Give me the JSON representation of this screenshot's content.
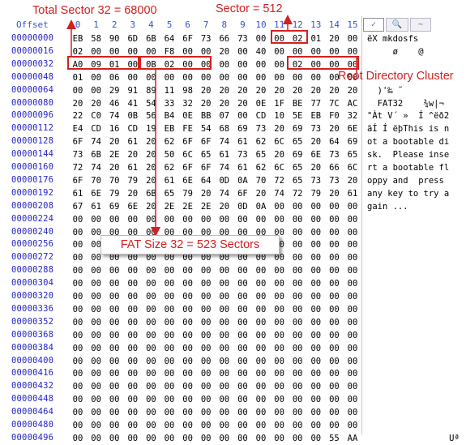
{
  "header": {
    "offset_label": "Offset",
    "columns": [
      "0",
      "1",
      "2",
      "3",
      "4",
      "5",
      "6",
      "7",
      "8",
      "9",
      "10",
      "11",
      "12",
      "13",
      "14",
      "15"
    ]
  },
  "toolbar": {
    "tab_1": "✓",
    "tab_2": "🔍",
    "tab_3": "~"
  },
  "annotations": {
    "total_sector": "Total Sector 32 = 68000",
    "sector_size": "Sector = 512",
    "root_dir": "Root Directory Cluster",
    "fat_size": "FAT Size 32 = 523 Sectors"
  },
  "colors": {
    "annotation": "#d42020",
    "offset_text": "#2424c8"
  },
  "rows": [
    {
      "offset": "00000000",
      "bytes": [
        "EB",
        "58",
        "90",
        "6D",
        "6B",
        "64",
        "6F",
        "73",
        "66",
        "73",
        "00",
        "00",
        "02",
        "01",
        "20",
        "00"
      ],
      "ascii": "ëX mkdosfs"
    },
    {
      "offset": "00000016",
      "bytes": [
        "02",
        "00",
        "00",
        "00",
        "00",
        "F8",
        "00",
        "00",
        "20",
        "00",
        "40",
        "00",
        "00",
        "00",
        "00",
        "00"
      ],
      "ascii": "     ø    @"
    },
    {
      "offset": "00000032",
      "bytes": [
        "A0",
        "09",
        "01",
        "00",
        "0B",
        "02",
        "00",
        "00",
        "00",
        "00",
        "00",
        "00",
        "02",
        "00",
        "00",
        "00"
      ],
      "ascii": ""
    },
    {
      "offset": "00000048",
      "bytes": [
        "01",
        "00",
        "06",
        "00",
        "00",
        "00",
        "00",
        "00",
        "00",
        "00",
        "00",
        "00",
        "00",
        "00",
        "00",
        "00"
      ],
      "ascii": ""
    },
    {
      "offset": "00000064",
      "bytes": [
        "00",
        "00",
        "29",
        "91",
        "89",
        "11",
        "98",
        "20",
        "20",
        "20",
        "20",
        "20",
        "20",
        "20",
        "20",
        "20"
      ],
      "ascii": "  )'‰ ˜"
    },
    {
      "offset": "00000080",
      "bytes": [
        "20",
        "20",
        "46",
        "41",
        "54",
        "33",
        "32",
        "20",
        "20",
        "20",
        "0E",
        "1F",
        "BE",
        "77",
        "7C",
        "AC"
      ],
      "ascii": "  FAT32    ¾w|¬"
    },
    {
      "offset": "00000096",
      "bytes": [
        "22",
        "C0",
        "74",
        "0B",
        "56",
        "B4",
        "0E",
        "BB",
        "07",
        "00",
        "CD",
        "10",
        "5E",
        "EB",
        "F0",
        "32"
      ],
      "ascii": "\"Àt V´ »  Í ^ëð2"
    },
    {
      "offset": "00000112",
      "bytes": [
        "E4",
        "CD",
        "16",
        "CD",
        "19",
        "EB",
        "FE",
        "54",
        "68",
        "69",
        "73",
        "20",
        "69",
        "73",
        "20",
        "6E"
      ],
      "ascii": "äÍ Í ëþThis is n"
    },
    {
      "offset": "00000128",
      "bytes": [
        "6F",
        "74",
        "20",
        "61",
        "20",
        "62",
        "6F",
        "6F",
        "74",
        "61",
        "62",
        "6C",
        "65",
        "20",
        "64",
        "69"
      ],
      "ascii": "ot a bootable di"
    },
    {
      "offset": "00000144",
      "bytes": [
        "73",
        "6B",
        "2E",
        "20",
        "20",
        "50",
        "6C",
        "65",
        "61",
        "73",
        "65",
        "20",
        "69",
        "6E",
        "73",
        "65"
      ],
      "ascii": "sk.  Please inse"
    },
    {
      "offset": "00000160",
      "bytes": [
        "72",
        "74",
        "20",
        "61",
        "20",
        "62",
        "6F",
        "6F",
        "74",
        "61",
        "62",
        "6C",
        "65",
        "20",
        "66",
        "6C"
      ],
      "ascii": "rt a bootable fl"
    },
    {
      "offset": "00000176",
      "bytes": [
        "6F",
        "70",
        "70",
        "79",
        "20",
        "61",
        "6E",
        "64",
        "0D",
        "0A",
        "70",
        "72",
        "65",
        "73",
        "73",
        "20"
      ],
      "ascii": "oppy and  press "
    },
    {
      "offset": "00000192",
      "bytes": [
        "61",
        "6E",
        "79",
        "20",
        "6B",
        "65",
        "79",
        "20",
        "74",
        "6F",
        "20",
        "74",
        "72",
        "79",
        "20",
        "61"
      ],
      "ascii": "any key to try a"
    },
    {
      "offset": "00000208",
      "bytes": [
        "67",
        "61",
        "69",
        "6E",
        "20",
        "2E",
        "2E",
        "2E",
        "20",
        "0D",
        "0A",
        "00",
        "00",
        "00",
        "00",
        "00"
      ],
      "ascii": "gain ..."
    },
    {
      "offset": "00000224",
      "bytes": [
        "00",
        "00",
        "00",
        "00",
        "00",
        "00",
        "00",
        "00",
        "00",
        "00",
        "00",
        "00",
        "00",
        "00",
        "00",
        "00"
      ],
      "ascii": ""
    },
    {
      "offset": "00000240",
      "bytes": [
        "00",
        "00",
        "00",
        "00",
        "00",
        "00",
        "00",
        "00",
        "00",
        "00",
        "00",
        "00",
        "00",
        "00",
        "00",
        "00"
      ],
      "ascii": ""
    },
    {
      "offset": "00000256",
      "bytes": [
        "00",
        "00",
        "00",
        "00",
        "00",
        "00",
        "00",
        "00",
        "00",
        "00",
        "00",
        "00",
        "00",
        "00",
        "00",
        "00"
      ],
      "ascii": ""
    },
    {
      "offset": "00000272",
      "bytes": [
        "00",
        "00",
        "00",
        "00",
        "00",
        "00",
        "00",
        "00",
        "00",
        "00",
        "00",
        "00",
        "00",
        "00",
        "00",
        "00"
      ],
      "ascii": ""
    },
    {
      "offset": "00000288",
      "bytes": [
        "00",
        "00",
        "00",
        "00",
        "00",
        "00",
        "00",
        "00",
        "00",
        "00",
        "00",
        "00",
        "00",
        "00",
        "00",
        "00"
      ],
      "ascii": ""
    },
    {
      "offset": "00000304",
      "bytes": [
        "00",
        "00",
        "00",
        "00",
        "00",
        "00",
        "00",
        "00",
        "00",
        "00",
        "00",
        "00",
        "00",
        "00",
        "00",
        "00"
      ],
      "ascii": ""
    },
    {
      "offset": "00000320",
      "bytes": [
        "00",
        "00",
        "00",
        "00",
        "00",
        "00",
        "00",
        "00",
        "00",
        "00",
        "00",
        "00",
        "00",
        "00",
        "00",
        "00"
      ],
      "ascii": ""
    },
    {
      "offset": "00000336",
      "bytes": [
        "00",
        "00",
        "00",
        "00",
        "00",
        "00",
        "00",
        "00",
        "00",
        "00",
        "00",
        "00",
        "00",
        "00",
        "00",
        "00"
      ],
      "ascii": ""
    },
    {
      "offset": "00000352",
      "bytes": [
        "00",
        "00",
        "00",
        "00",
        "00",
        "00",
        "00",
        "00",
        "00",
        "00",
        "00",
        "00",
        "00",
        "00",
        "00",
        "00"
      ],
      "ascii": ""
    },
    {
      "offset": "00000368",
      "bytes": [
        "00",
        "00",
        "00",
        "00",
        "00",
        "00",
        "00",
        "00",
        "00",
        "00",
        "00",
        "00",
        "00",
        "00",
        "00",
        "00"
      ],
      "ascii": ""
    },
    {
      "offset": "00000384",
      "bytes": [
        "00",
        "00",
        "00",
        "00",
        "00",
        "00",
        "00",
        "00",
        "00",
        "00",
        "00",
        "00",
        "00",
        "00",
        "00",
        "00"
      ],
      "ascii": ""
    },
    {
      "offset": "00000400",
      "bytes": [
        "00",
        "00",
        "00",
        "00",
        "00",
        "00",
        "00",
        "00",
        "00",
        "00",
        "00",
        "00",
        "00",
        "00",
        "00",
        "00"
      ],
      "ascii": ""
    },
    {
      "offset": "00000416",
      "bytes": [
        "00",
        "00",
        "00",
        "00",
        "00",
        "00",
        "00",
        "00",
        "00",
        "00",
        "00",
        "00",
        "00",
        "00",
        "00",
        "00"
      ],
      "ascii": ""
    },
    {
      "offset": "00000432",
      "bytes": [
        "00",
        "00",
        "00",
        "00",
        "00",
        "00",
        "00",
        "00",
        "00",
        "00",
        "00",
        "00",
        "00",
        "00",
        "00",
        "00"
      ],
      "ascii": ""
    },
    {
      "offset": "00000448",
      "bytes": [
        "00",
        "00",
        "00",
        "00",
        "00",
        "00",
        "00",
        "00",
        "00",
        "00",
        "00",
        "00",
        "00",
        "00",
        "00",
        "00"
      ],
      "ascii": ""
    },
    {
      "offset": "00000464",
      "bytes": [
        "00",
        "00",
        "00",
        "00",
        "00",
        "00",
        "00",
        "00",
        "00",
        "00",
        "00",
        "00",
        "00",
        "00",
        "00",
        "00"
      ],
      "ascii": ""
    },
    {
      "offset": "00000480",
      "bytes": [
        "00",
        "00",
        "00",
        "00",
        "00",
        "00",
        "00",
        "00",
        "00",
        "00",
        "00",
        "00",
        "00",
        "00",
        "00",
        "00"
      ],
      "ascii": ""
    },
    {
      "offset": "00000496",
      "bytes": [
        "00",
        "00",
        "00",
        "00",
        "00",
        "00",
        "00",
        "00",
        "00",
        "00",
        "00",
        "00",
        "00",
        "00",
        "55",
        "AA"
      ],
      "ascii": "                Uª"
    }
  ]
}
